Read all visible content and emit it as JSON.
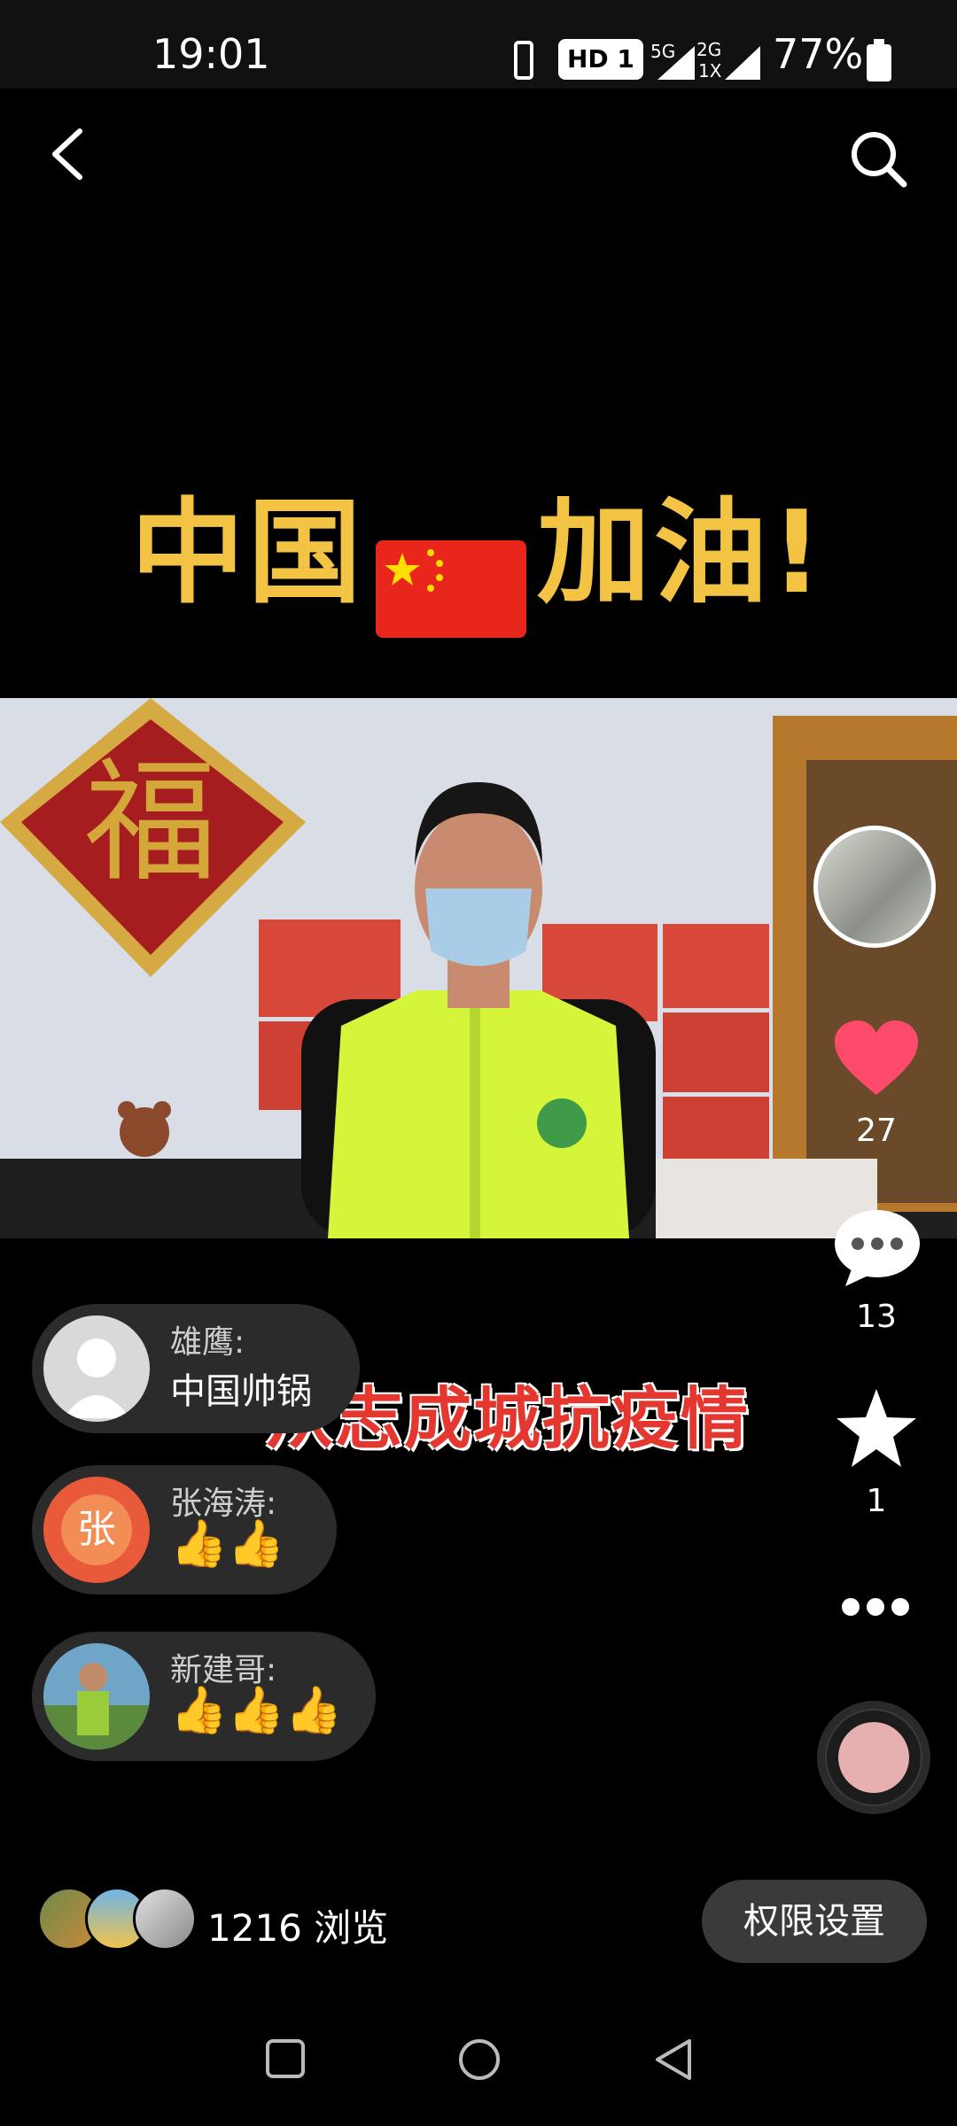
{
  "status_bar": {
    "time": "19:01",
    "network_label": "HD 1",
    "signal_5g": "5G",
    "signal_2g": "2G",
    "signal_1x": "1X",
    "battery": "77%"
  },
  "icons": {
    "back": "back-arrow-icon",
    "search": "search-icon",
    "like": "heart-icon",
    "comment": "comment-bubble-icon",
    "favorite": "star-icon",
    "more": "more-dots-icon",
    "music": "music-disc-icon"
  },
  "banner": {
    "text_left": "中国",
    "text_right": "加油!"
  },
  "video": {
    "subtitle": "从志成城抗疫情"
  },
  "actions": {
    "likes": "27",
    "comments": "13",
    "favorites": "1"
  },
  "comments": [
    {
      "name": "雄鹰:",
      "text": "中国帅锅"
    },
    {
      "name": "张海涛:",
      "text": "👍👍",
      "avatar_char": "张"
    },
    {
      "name": "新建哥:",
      "text": "👍👍👍"
    }
  ],
  "footer": {
    "views": "1216 浏览",
    "permission_button": "权限设置"
  },
  "colors": {
    "banner_yellow": "#f3c343",
    "heart_red": "#ff4b6b",
    "subtitle_red": "#e4372f",
    "vest_green": "#d4f53a"
  }
}
